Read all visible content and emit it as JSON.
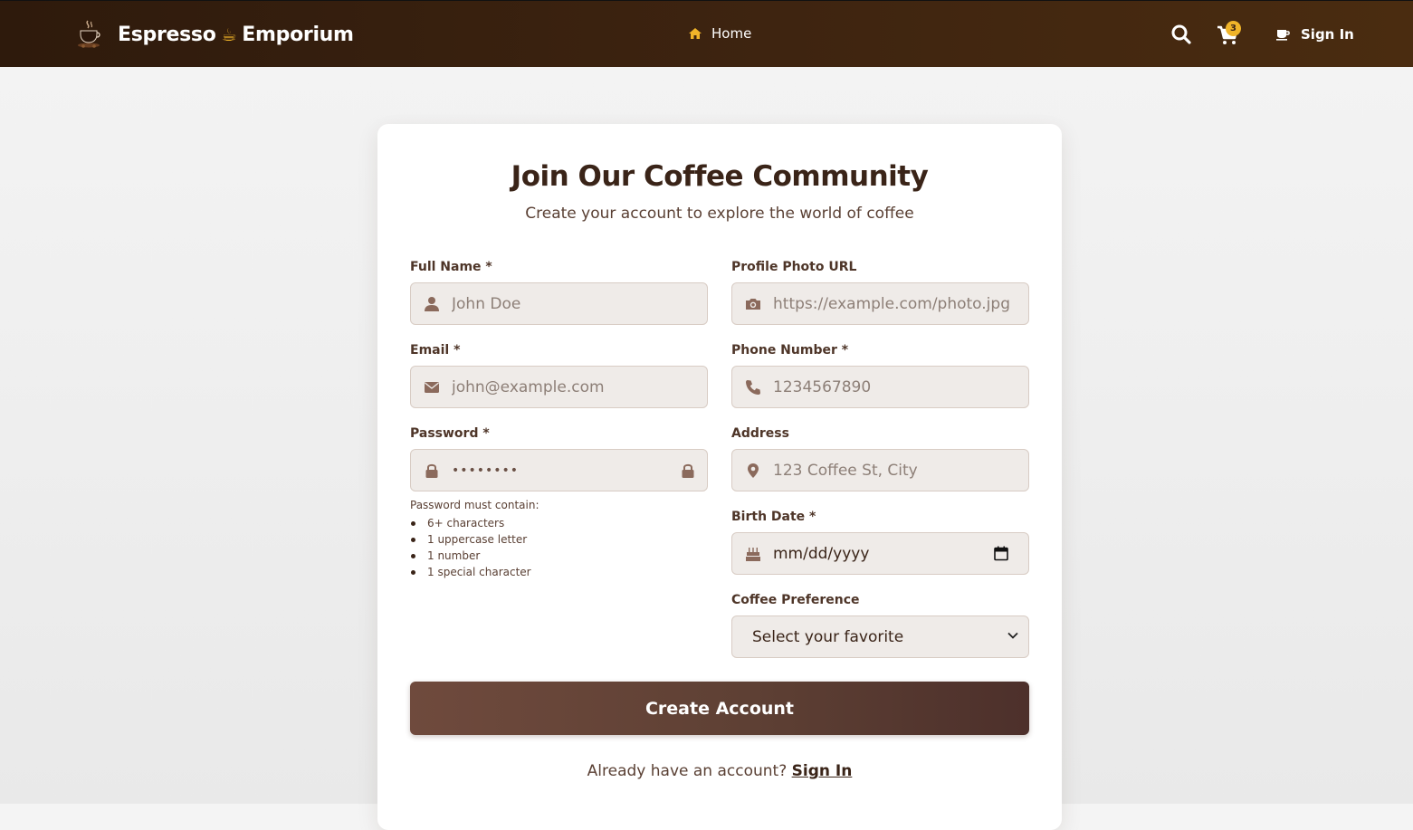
{
  "navbar": {
    "brand_left": "Espresso",
    "brand_cup": "☕",
    "brand_right": "Emporium",
    "home_label": "Home",
    "cart_count": "3",
    "signin_label": "Sign In"
  },
  "form": {
    "title": "Join Our Coffee Community",
    "subtitle": "Create your account to explore the world of coffee",
    "full_name": {
      "label": "Full Name *",
      "placeholder": "John Doe"
    },
    "photo_url": {
      "label": "Profile Photo URL",
      "placeholder": "https://example.com/photo.jpg"
    },
    "email": {
      "label": "Email *",
      "placeholder": "john@example.com"
    },
    "phone": {
      "label": "Phone Number *",
      "placeholder": "1234567890"
    },
    "password": {
      "label": "Password *",
      "masked_value": "••••••••"
    },
    "address": {
      "label": "Address",
      "placeholder": "123 Coffee St, City"
    },
    "birth_date": {
      "label": "Birth Date *",
      "value": "mm/dd/yyyy"
    },
    "coffee_pref": {
      "label": "Coffee Preference",
      "selected": "Select your favorite"
    },
    "password_help": {
      "intro": "Password must contain:",
      "rules": [
        "6+ characters",
        "1 uppercase letter",
        "1 number",
        "1 special character"
      ]
    },
    "submit_label": "Create Account",
    "footer_text": "Already have an account?",
    "footer_link": "Sign In"
  },
  "colors": {
    "navbar_bg": "#3e2410",
    "accent_gold": "#f0b429",
    "primary_brown": "#5e4034",
    "field_bg": "#efebe8",
    "icon_brown": "#8b6a5c"
  },
  "icons": [
    "coffee-logo-icon",
    "home-icon",
    "search-icon",
    "cart-icon",
    "coffee-cup-icon",
    "user-icon",
    "camera-icon",
    "envelope-icon",
    "phone-icon",
    "lock-icon",
    "map-marker-icon",
    "birthday-cake-icon",
    "calendar-icon",
    "chevron-down-icon"
  ]
}
